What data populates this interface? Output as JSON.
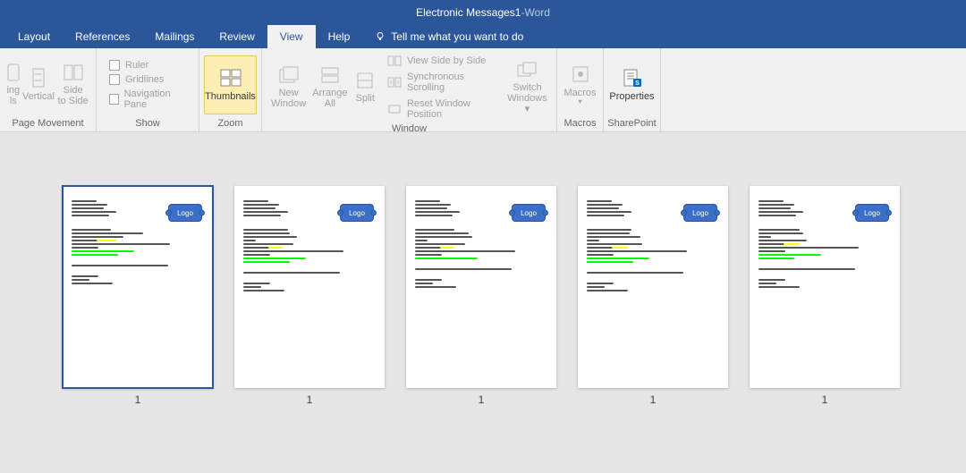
{
  "title": {
    "doc": "Electronic Messages1",
    "sep": "  -  ",
    "app": "Word"
  },
  "tabs": {
    "layout": "Layout",
    "references": "References",
    "mailings": "Mailings",
    "review": "Review",
    "view": "View",
    "help": "Help"
  },
  "tell_me": "Tell me what you want to do",
  "ribbon": {
    "page_movement": {
      "label": "Page Movement",
      "scrolling_top": "ing",
      "scrolling_bottom": "ls",
      "vertical": "Vertical",
      "side_top": "Side",
      "side_bottom": "to Side"
    },
    "show": {
      "label": "Show",
      "ruler": "Ruler",
      "gridlines": "Gridlines",
      "navpane": "Navigation Pane"
    },
    "zoom": {
      "label": "Zoom",
      "thumbnails": "Thumbnails"
    },
    "window": {
      "label": "Window",
      "new_top": "New",
      "new_bottom": "Window",
      "arrange_top": "Arrange",
      "arrange_bottom": "All",
      "split": "Split",
      "side_by_side": "View Side by Side",
      "sync_scroll": "Synchronous Scrolling",
      "reset_pos": "Reset Window Position",
      "switch_top": "Switch",
      "switch_bottom": "Windows"
    },
    "macros": {
      "label": "Macros",
      "btn": "Macros"
    },
    "sharepoint": {
      "label": "SharePoint",
      "btn": "Properties"
    }
  },
  "thumbnails": {
    "logo": "Logo",
    "pages": [
      "1",
      "1",
      "1",
      "1",
      "1"
    ]
  }
}
